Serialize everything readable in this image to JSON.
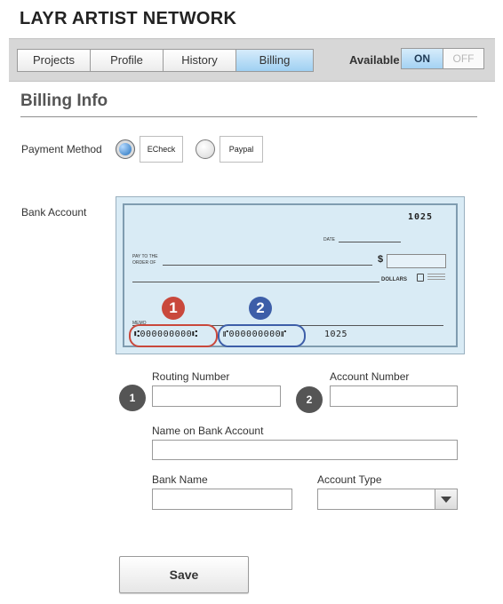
{
  "app": {
    "title": "LAYR ARTIST NETWORK"
  },
  "nav": {
    "tabs": [
      {
        "label": "Projects"
      },
      {
        "label": "Profile"
      },
      {
        "label": "History"
      },
      {
        "label": "Billing",
        "active": true
      }
    ],
    "availability": {
      "label": "Available",
      "on_label": "ON",
      "off_label": "OFF",
      "selected": "ON"
    }
  },
  "billing": {
    "section_title": "Billing Info",
    "payment_method": {
      "label": "Payment Method",
      "options": [
        {
          "label": "ECheck",
          "selected": true
        },
        {
          "label": "Paypal",
          "selected": false
        }
      ]
    },
    "bank_account_label": "Bank Account",
    "check_image": {
      "check_number": "1025",
      "date_label": "DATE",
      "pay_to_line1": "PAY TO THE",
      "pay_to_line2": "ORDER OF",
      "dollar_sign": "$",
      "dollars_label": "DOLLARS",
      "memo_label": "MEMO",
      "routing_micr": "⑆000000000⑆",
      "account_micr": "⑈000000000⑈",
      "check_micr": "1025",
      "callout_1": "1",
      "callout_2": "2"
    },
    "fields": {
      "routing_number": {
        "label": "Routing Number",
        "badge": "1",
        "value": ""
      },
      "account_number": {
        "label": "Account Number",
        "badge": "2",
        "value": ""
      },
      "name_on_account": {
        "label": "Name on Bank Account",
        "value": ""
      },
      "bank_name": {
        "label": "Bank Name",
        "value": ""
      },
      "account_type": {
        "label": "Account Type",
        "value": ""
      }
    },
    "save_label": "Save"
  },
  "colors": {
    "active_tab": "#a8d6f6",
    "callout_red": "#c9483c",
    "callout_blue": "#3d5ea8",
    "badge_gray": "#555555"
  }
}
